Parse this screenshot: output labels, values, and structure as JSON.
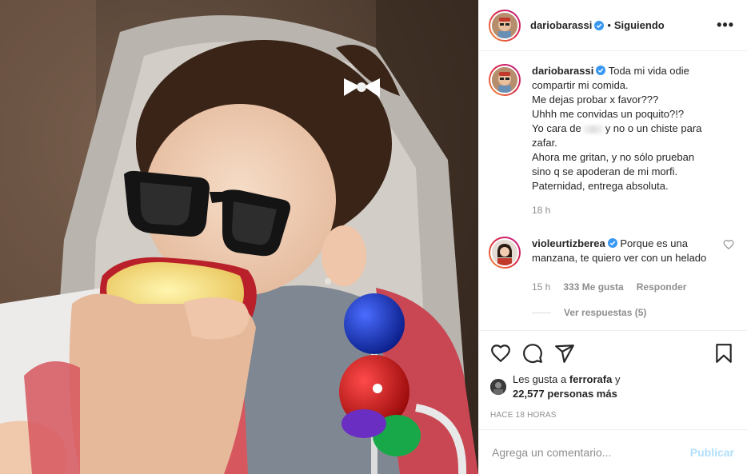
{
  "post": {
    "author": "dariobarassi",
    "follow_status": "Siguiendo",
    "separator": "•",
    "more_label": "•••"
  },
  "caption": {
    "author": "dariobarassi",
    "lines": [
      "Toda mi vida odie",
      "compartir mi comida.",
      "Me dejas probar x favor???",
      "Uhhh me convidas un poquito?!?",
      "Yo cara de",
      "y no o un chiste para",
      "zafar.",
      "Ahora me gritan, y no sólo prueban",
      "sino q se apoderan de mi morfi.",
      "Paternidad, entrega absoluta."
    ],
    "time": "18 h"
  },
  "comment": {
    "author": "violeurtizberea",
    "text": "Porque es una manzana, te quiero ver con un helado",
    "time": "15 h",
    "likes": "333 Me gusta",
    "reply": "Responder",
    "view_replies": "Ver respuestas (5)"
  },
  "likes": {
    "prefix": "Les gusta a",
    "user": "ferrorafa",
    "suffix": "y",
    "count": "22,577 personas más"
  },
  "timeago": "HACE 18 HORAS",
  "add_comment": {
    "placeholder": "Agrega un comentario...",
    "publish": "Publicar"
  },
  "colors": {
    "verified": "#3897f0",
    "publish_disabled": "#b2dffc",
    "muted": "#8e8e8e"
  },
  "icons": [
    "verified-badge-icon",
    "heart-icon",
    "comment-icon",
    "share-icon",
    "bookmark-icon",
    "more-options-icon"
  ]
}
